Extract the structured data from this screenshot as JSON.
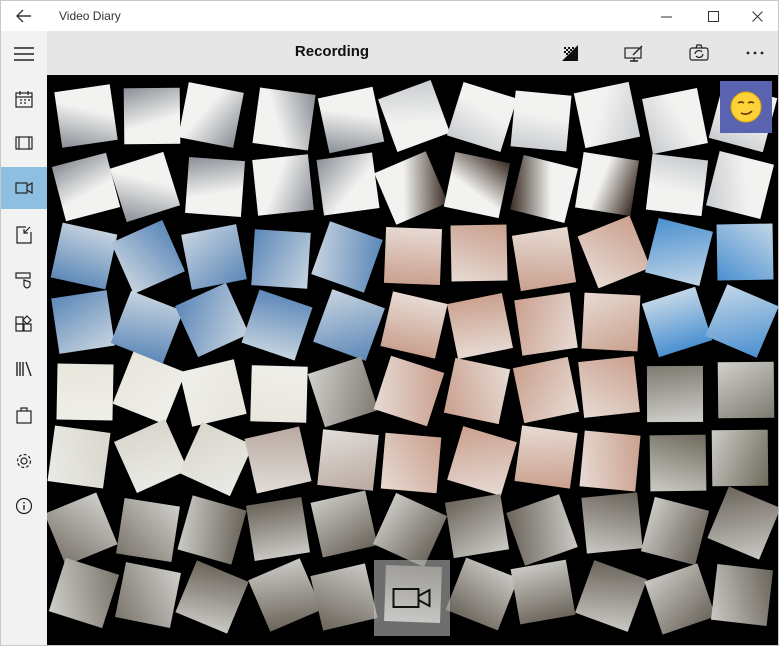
{
  "window": {
    "title": "Video Diary",
    "back_icon": "back-arrow-icon",
    "controls": [
      "minimize-icon",
      "maximize-icon",
      "close-icon"
    ]
  },
  "header": {
    "title": "Recording",
    "actions": [
      "effects-icon",
      "edit-icon",
      "switch-camera-icon",
      "more-icon"
    ]
  },
  "sidebar": {
    "items": [
      {
        "icon": "hamburger-menu-icon"
      },
      {
        "icon": "calendar-icon"
      },
      {
        "icon": "film-icon"
      },
      {
        "icon": "video-camera-icon",
        "active": true
      },
      {
        "icon": "import-icon"
      },
      {
        "icon": "shield-tag-icon"
      },
      {
        "icon": "add-apps-icon"
      },
      {
        "icon": "library-icon"
      },
      {
        "icon": "shopping-bag-icon"
      },
      {
        "icon": "settings-gear-icon"
      },
      {
        "icon": "info-icon"
      }
    ],
    "active_color": "#8fbfe0"
  },
  "camera": {
    "effect_button_icon": "smiley-face-icon",
    "effect_button_color": "#5a63b0",
    "record_button_icon": "video-camera-icon"
  }
}
